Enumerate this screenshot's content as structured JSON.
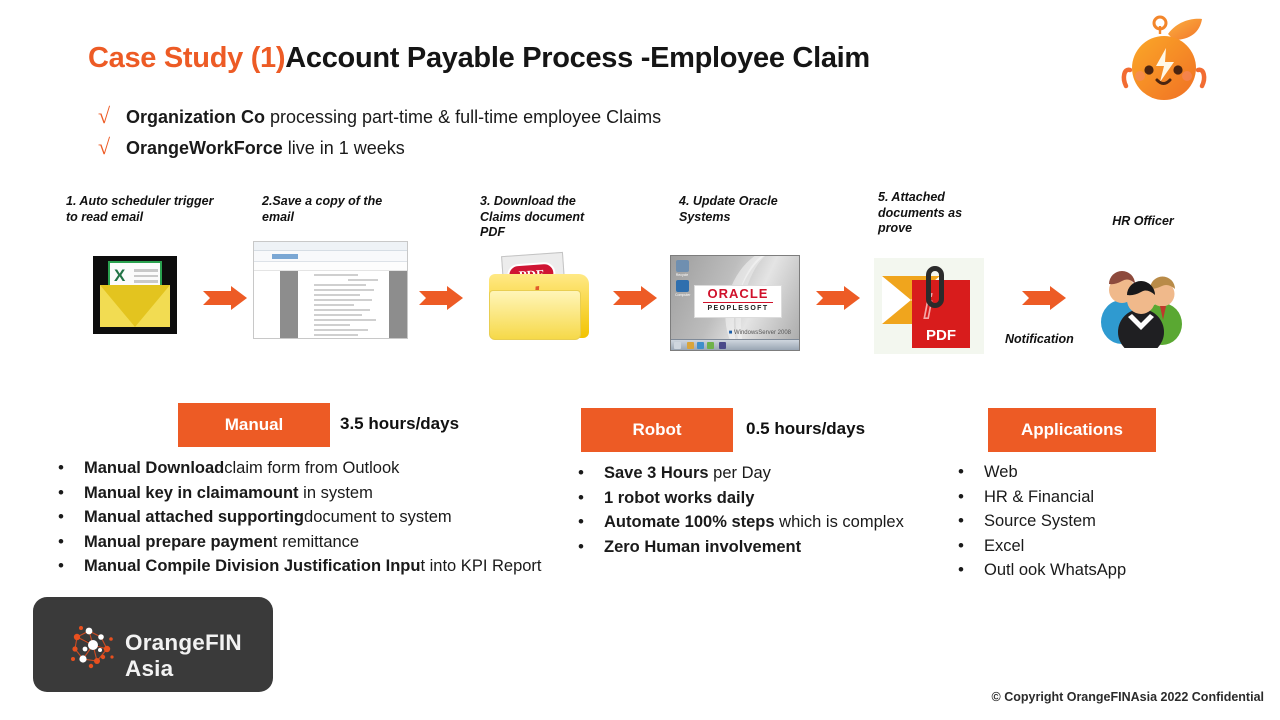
{
  "slide": {
    "title_accent": "Case Study (1)",
    "title_main": "Account Payable Process -Employee Claim",
    "check_bullets": [
      {
        "mark": "✓",
        "bold": "Organization Co",
        "rest": " processing part-time & full-time employee Claims"
      },
      {
        "mark": "✓",
        "bold": "OrangeWorkForce",
        "rest": " live in 1 weeks"
      }
    ],
    "mascot_icon": "orange-mascot-icon"
  },
  "flow": {
    "steps": [
      {
        "label": "1. Auto scheduler trigger to read email",
        "icon": "email-excel-icon"
      },
      {
        "label": "2.Save a copy of the email",
        "icon": "document-viewer-icon"
      },
      {
        "label": "3. Download the Claims document PDF",
        "icon": "pdf-folder-icon"
      },
      {
        "label": "4. Update Oracle Systems",
        "icon": "oracle-peoplesoft-icon"
      },
      {
        "label": "5. Attached documents as prove",
        "icon": "pdf-attachment-icon"
      }
    ],
    "notification_label": "Notification",
    "recipient_label": "HR Officer",
    "recipient_icon": "people-group-icon",
    "arrow_icon": "arrow-right-icon"
  },
  "panels": {
    "manual": {
      "heading": "Manual",
      "hours": "3.5 hours/days",
      "bullets": [
        {
          "bold": "Manual Download",
          "rest": "claim form from Outlook"
        },
        {
          "bold": "Manual key in claimamount",
          "rest": " in system"
        },
        {
          "bold": "Manual attached supporting",
          "rest": "document to system"
        },
        {
          "bold": "Manual prepare paymen",
          "rest": "t remittance"
        },
        {
          "bold": "Manual Compile Division Justification Inpu",
          "rest": "t into KPI Report"
        }
      ]
    },
    "robot": {
      "heading": "Robot",
      "hours": "0.5 hours/days",
      "bullets": [
        {
          "bold": "Save 3 Hours",
          "rest": " per Day"
        },
        {
          "bold": "1 robot works daily",
          "rest": ""
        },
        {
          "bold": "Automate 100% steps",
          "rest": " which is complex"
        },
        {
          "bold": "Zero Human involvement",
          "rest": ""
        }
      ]
    },
    "applications": {
      "heading": "Applications",
      "bullets": [
        {
          "bold": "",
          "rest": "Web"
        },
        {
          "bold": "",
          "rest": "HR & Financial"
        },
        {
          "bold": "",
          "rest": "Source System"
        },
        {
          "bold": "",
          "rest": "Excel"
        },
        {
          "bold": "",
          "rest": "Outl ook WhatsApp"
        }
      ]
    }
  },
  "logo": {
    "text": "OrangeFIN Asia",
    "mark_icon": "network-sphere-icon"
  },
  "footer": {
    "copyright": "© Copyright OrangeFINAsia 2022 Confidential"
  },
  "colors": {
    "accent": "#ED5B25",
    "dark": "#3A3A3A",
    "text": "#1A1A1A"
  }
}
